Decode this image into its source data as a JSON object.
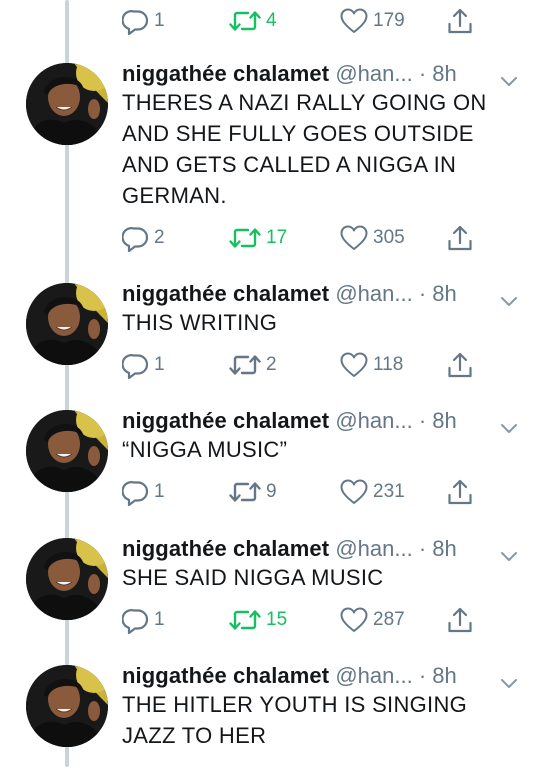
{
  "colors": {
    "grey": "#657786",
    "retweet_green": "#17bf63",
    "thread_line": "#c9d3da",
    "text": "#14171a"
  },
  "icons": {
    "reply": "speech-bubble-icon",
    "retweet": "retweet-arrows-icon",
    "like": "heart-icon",
    "share": "share-upload-icon",
    "more": "chevron-down-icon"
  },
  "top_actions": {
    "replies": "1",
    "retweets": "4",
    "likes": "179",
    "retweeted": true
  },
  "tweets": [
    {
      "name": "niggathée chalamet",
      "handle": "@han...",
      "sep": "·",
      "time": "8h",
      "lines": [
        "THERES A NAZI RALLY GOING ON",
        "AND SHE FULLY GOES OUTSIDE",
        "AND GETS CALLED A NIGGA IN",
        "GERMAN."
      ],
      "replies": "2",
      "retweets": "17",
      "likes": "305",
      "retweeted": true
    },
    {
      "name": "niggathée chalamet",
      "handle": "@han...",
      "sep": "·",
      "time": "8h",
      "lines": [
        "THIS WRITING"
      ],
      "replies": "1",
      "retweets": "2",
      "likes": "118",
      "retweeted": false
    },
    {
      "name": "niggathée chalamet",
      "handle": "@han...",
      "sep": "·",
      "time": "8h",
      "lines": [
        "“NIGGA MUSIC”"
      ],
      "replies": "1",
      "retweets": "9",
      "likes": "231",
      "retweeted": false
    },
    {
      "name": "niggathée chalamet",
      "handle": "@han...",
      "sep": "·",
      "time": "8h",
      "lines": [
        "SHE SAID NIGGA MUSIC"
      ],
      "replies": "1",
      "retweets": "15",
      "likes": "287",
      "retweeted": true
    },
    {
      "name": "niggathée chalamet",
      "handle": "@han...",
      "sep": "·",
      "time": "8h",
      "lines": [
        "THE HITLER YOUTH IS SINGING",
        "JAZZ TO HER"
      ],
      "replies": null,
      "retweets": null,
      "likes": null,
      "retweeted": false
    }
  ]
}
